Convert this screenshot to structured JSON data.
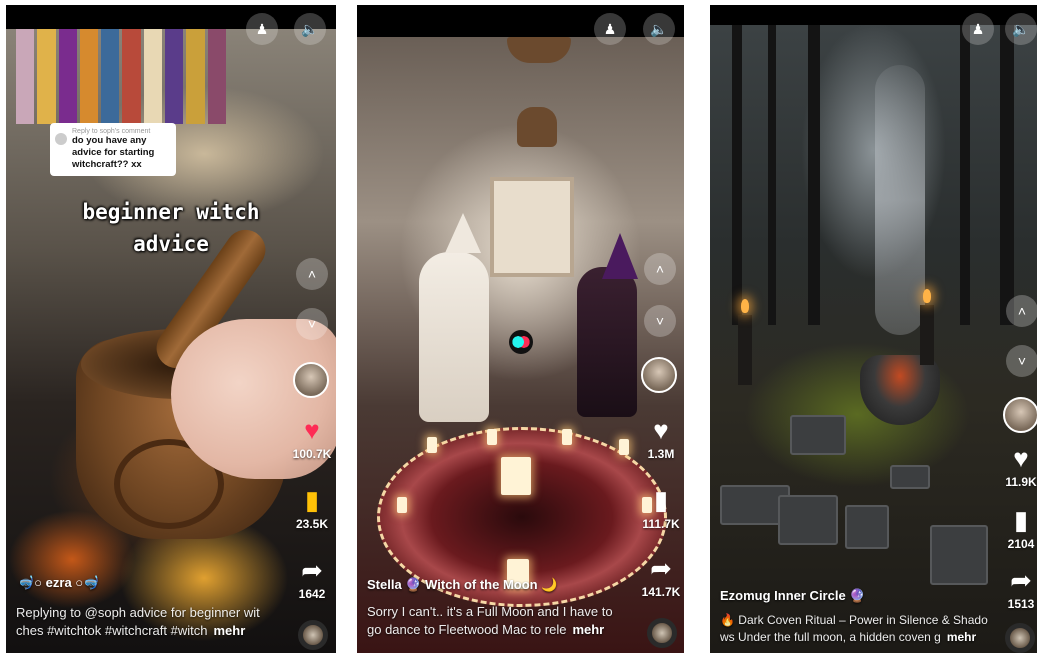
{
  "colors": {
    "like_active": "#fe2c55",
    "save_active": "#ffc107",
    "text": "#ffffff"
  },
  "videos": [
    {
      "reply": {
        "label": "Reply to soph's comment",
        "text": "do you have any advice for starting witchcraft?? xx"
      },
      "overlay_lines": [
        "beginner witch",
        "advice"
      ],
      "likes": "100.7K",
      "saves": "23.5K",
      "shares": "1642",
      "username": "🤿○ ezra ○🤿",
      "caption_line1": "Replying to @soph advice for beginner wit",
      "caption_line2": "ches #witchtok #witchcraft #witch",
      "more": "mehr"
    },
    {
      "likes": "1.3M",
      "saves": "111.7K",
      "shares": "141.7K",
      "username": "Stella 🔮 Witch of the Moon 🌙",
      "caption_line1": "Sorry I can't.. it's a Full Moon and I have to",
      "caption_line2": "go dance to Fleetwood Mac to rele",
      "more": "mehr"
    },
    {
      "likes": "11.9K",
      "saves": "2104",
      "shares": "1513",
      "username": "Ezomug Inner Circle 🔮",
      "caption_line1": "🔥 Dark Coven Ritual – Power in Silence & Shado",
      "caption_line2": "ws Under the full moon, a hidden coven g",
      "more": "mehr"
    }
  ],
  "icons": {
    "filter": "♟",
    "volume": "🔈",
    "up": "˄",
    "down": "˅",
    "heart": "♥",
    "bookmark": "▮",
    "share": "➦"
  }
}
